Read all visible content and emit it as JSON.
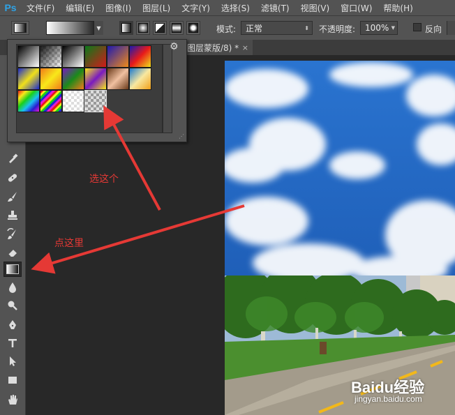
{
  "app": {
    "logo": "Ps"
  },
  "menu": [
    "文件(F)",
    "编辑(E)",
    "图像(I)",
    "图层(L)",
    "文字(Y)",
    "选择(S)",
    "滤镜(T)",
    "视图(V)",
    "窗口(W)",
    "帮助(H)"
  ],
  "options": {
    "mode_label": "模式:",
    "mode_value": "正常",
    "opacity_label": "不透明度:",
    "opacity_value": "100%",
    "reverse_label": "反向"
  },
  "document_tab": {
    "title": "图层蒙版/8) *",
    "close": "×"
  },
  "annotations": {
    "select_this": "选这个",
    "click_here": "点这里"
  },
  "watermark": {
    "brand": "Baidu经验",
    "url": "jingyan.baidu.com"
  },
  "colors": {
    "arrow": "#e53935",
    "ps_blue": "#2fa3e6"
  },
  "icons": [
    "gradient-tool-icon",
    "gear-icon",
    "eyedropper-icon",
    "healing-brush-icon",
    "brush-icon",
    "stamp-icon",
    "history-brush-icon",
    "eraser-icon",
    "drop-icon",
    "zoom-icon",
    "pen-icon",
    "type-icon",
    "path-select-icon",
    "rectangle-icon",
    "hand-icon"
  ]
}
